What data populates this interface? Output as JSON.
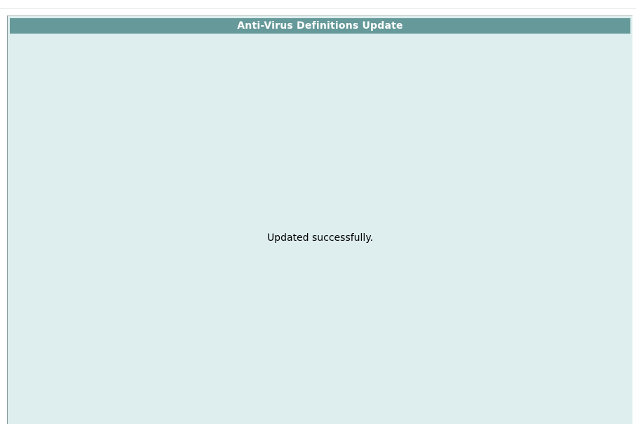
{
  "panel": {
    "title": "Anti-Virus Definitions Update",
    "message": "Updated successfully."
  },
  "colors": {
    "titlebar_bg": "#669999",
    "panel_bg": "#deeeee",
    "title_text": "#ffffff",
    "message_text": "#000000"
  }
}
